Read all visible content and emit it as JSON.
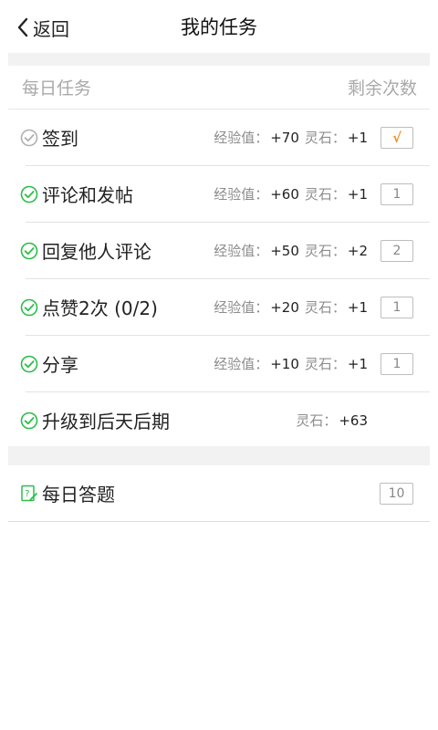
{
  "nav": {
    "back_label": "返回",
    "title": "我的任务"
  },
  "header": {
    "left": "每日任务",
    "right": "剩余次数"
  },
  "reward_labels": {
    "exp": "经验值：",
    "stone": "灵石："
  },
  "tasks": [
    {
      "name": "签到",
      "exp": "+70",
      "stone": "+1",
      "remaining": "√",
      "status": "done"
    },
    {
      "name": "评论和发帖",
      "exp": "+60",
      "stone": "+1",
      "remaining": "1",
      "status": "available"
    },
    {
      "name": "回复他人评论",
      "exp": "+50",
      "stone": "+2",
      "remaining": "2",
      "status": "available"
    },
    {
      "name": "点赞2次 (0/2)",
      "exp": "+20",
      "stone": "+1",
      "remaining": "1",
      "status": "available"
    },
    {
      "name": "分享",
      "exp": "+10",
      "stone": "+1",
      "remaining": "1",
      "status": "available"
    },
    {
      "name": "升级到后天后期",
      "stone": "+63",
      "status": "available"
    }
  ],
  "quiz": {
    "name": "每日答题",
    "remaining": "10"
  },
  "colors": {
    "check_done": "#b0b0b0",
    "check_available": "#2cbd4b",
    "done_mark": "#f0932a",
    "quiz_icon": "#2cbd4b"
  }
}
